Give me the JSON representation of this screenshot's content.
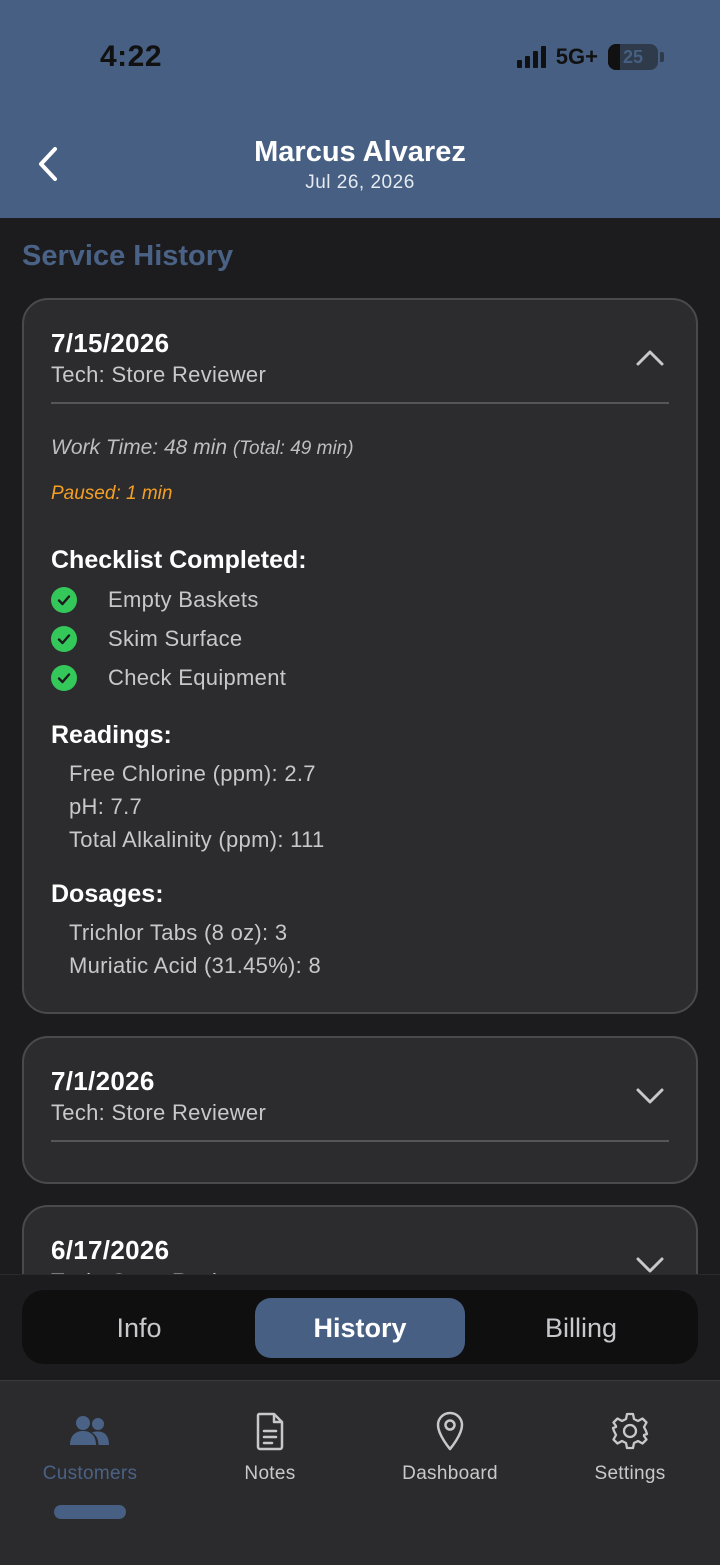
{
  "status_bar": {
    "time": "4:22",
    "network": "5G+",
    "battery": "25"
  },
  "header": {
    "title": "Marcus Alvarez",
    "subtitle": "Jul 26, 2026",
    "back_icon": "chevron-left-icon"
  },
  "section_title": "Service History",
  "visits": [
    {
      "date": "7/15/2026",
      "tech": "Tech: Store Reviewer",
      "expanded": true,
      "work_time": "Work Time: 48 min",
      "total_time": "(Total: 49 min)",
      "paused": "Paused: 1 min",
      "checklist_title": "Checklist Completed:",
      "checklist": [
        "Empty Baskets",
        "Skim Surface",
        "Check Equipment"
      ],
      "readings_title": "Readings:",
      "readings": [
        "Free Chlorine (ppm): 2.7",
        "pH: 7.7",
        "Total Alkalinity (ppm): 111"
      ],
      "dosages_title": "Dosages:",
      "dosages": [
        "Trichlor Tabs (8 oz): 3",
        "Muriatic Acid (31.45%): 8"
      ]
    },
    {
      "date": "7/1/2026",
      "tech": "Tech: Store Reviewer",
      "expanded": false
    },
    {
      "date": "6/17/2026",
      "tech": "Tech: Store Reviewer",
      "expanded": false
    }
  ],
  "segments": {
    "items": [
      "Info",
      "History",
      "Billing"
    ],
    "active": "History"
  },
  "tabbar": {
    "items": [
      {
        "label": "Customers",
        "icon": "people-icon",
        "active": true
      },
      {
        "label": "Notes",
        "icon": "document-icon",
        "active": false
      },
      {
        "label": "Dashboard",
        "icon": "map-pin-icon",
        "active": false
      },
      {
        "label": "Settings",
        "icon": "gear-icon",
        "active": false
      }
    ]
  },
  "colors": {
    "header": "#465f82",
    "accent": "#4a6285",
    "background": "#1c1c1e",
    "card": "#2c2c2e",
    "check": "#34c759",
    "paused": "#f5a024"
  }
}
